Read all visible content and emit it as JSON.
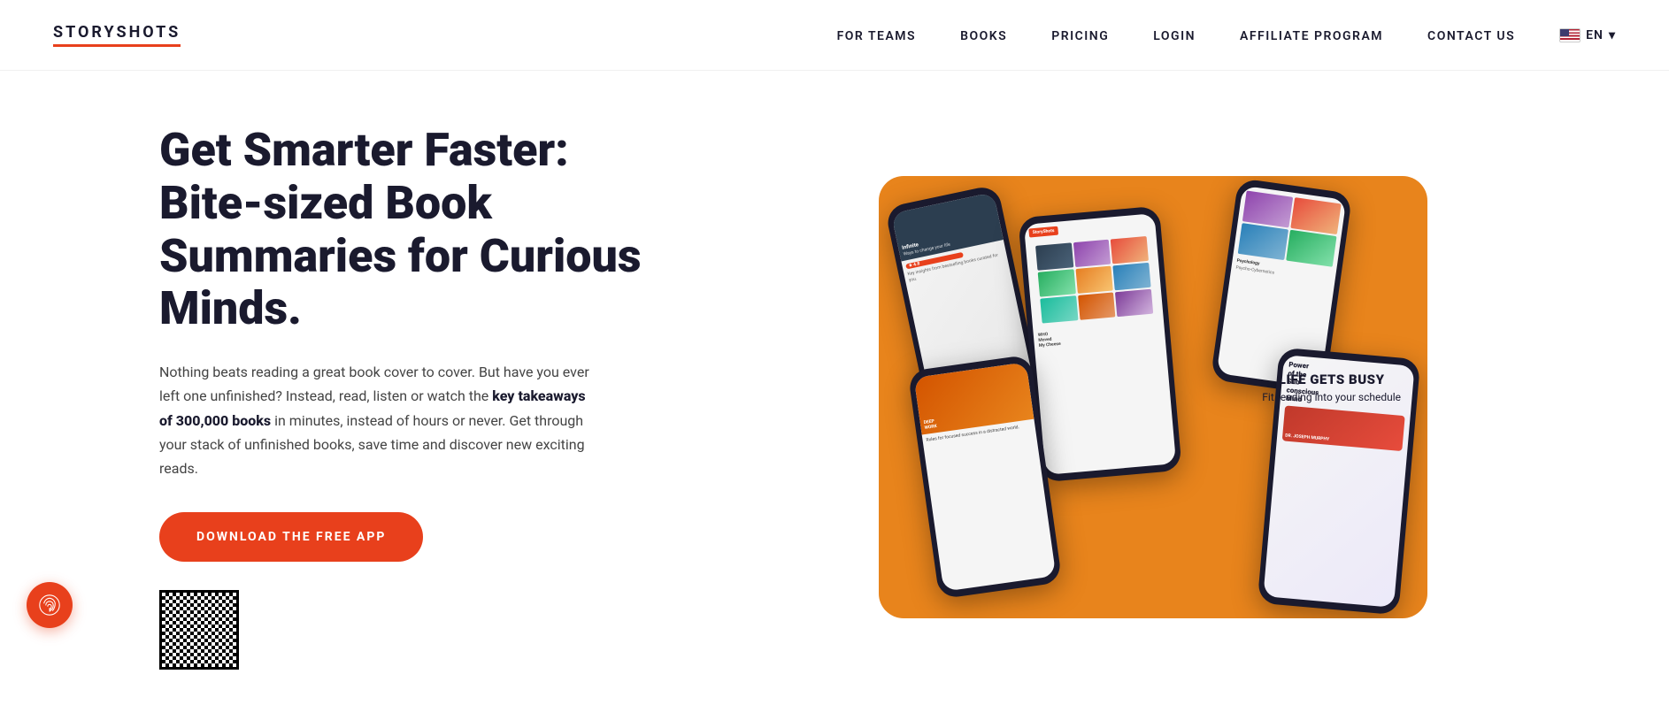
{
  "logo": {
    "text": "STORYSHOTS"
  },
  "nav": {
    "links": [
      {
        "label": "FOR TEAMS",
        "id": "for-teams"
      },
      {
        "label": "BOOKS",
        "id": "books"
      },
      {
        "label": "PRICING",
        "id": "pricing"
      },
      {
        "label": "LOGIN",
        "id": "login"
      },
      {
        "label": "AFFILIATE PROGRAM",
        "id": "affiliate"
      },
      {
        "label": "CONTACT US",
        "id": "contact"
      }
    ],
    "lang": "EN",
    "lang_arrow": "▾"
  },
  "hero": {
    "title": "Get Smarter Faster: Bite-sized Book Summaries for Curious Minds.",
    "description_1": "Nothing beats reading a great book cover to cover. But have you ever left one unfinished? Instead, read, listen or watch the ",
    "description_bold": "key takeaways of 300,000 books",
    "description_2": " in minutes, instead of hours or never. Get through your stack of unfinished books, save time and discover new exciting reads.",
    "cta_button": "DOWNLOAD THE FREE APP"
  },
  "image_card": {
    "life_gets_busy_title": "LIFE GETS BUSY",
    "life_gets_busy_sub": "Fit reading into your schedule"
  },
  "fingerprint": {
    "label": "fingerprint"
  }
}
